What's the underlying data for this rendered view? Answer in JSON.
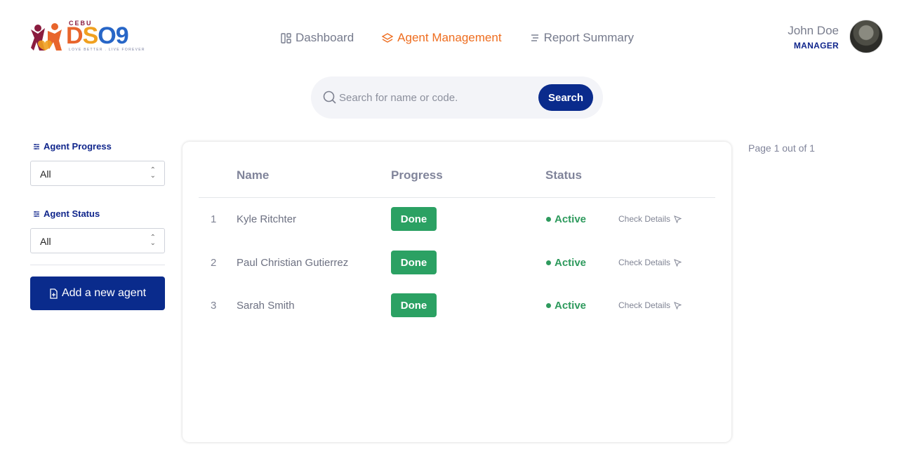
{
  "brand": {
    "top": "CEBU",
    "name_parts": [
      "D",
      "S",
      "O",
      "9"
    ],
    "tagline": "LOVE BETTER . LIVE FOREVER"
  },
  "nav": {
    "items": [
      {
        "label": "Dashboard",
        "icon": "dashboard-icon",
        "active": false
      },
      {
        "label": "Agent Management",
        "icon": "layers-icon",
        "active": true
      },
      {
        "label": "Report Summary",
        "icon": "list-icon",
        "active": false
      }
    ]
  },
  "user": {
    "name": "John Doe",
    "role": "MANAGER"
  },
  "search": {
    "placeholder": "Search for name or code.",
    "value": "",
    "button_label": "Search"
  },
  "filters": {
    "progress": {
      "label": "Agent Progress",
      "selected": "All"
    },
    "status": {
      "label": "Agent Status",
      "selected": "All"
    }
  },
  "add_agent_label": "Add a new agent",
  "table": {
    "columns": [
      "Name",
      "Progress",
      "Status"
    ],
    "rows": [
      {
        "num": "1",
        "name": "Kyle Ritchter",
        "progress": "Done",
        "status": "Active",
        "action": "Check Details"
      },
      {
        "num": "2",
        "name": "Paul Christian Gutierrez",
        "progress": "Done",
        "status": "Active",
        "action": "Check Details"
      },
      {
        "num": "3",
        "name": "Sarah Smith",
        "progress": "Done",
        "status": "Active",
        "action": "Check Details"
      }
    ]
  },
  "pagination": {
    "text": "Page 1 out of 1"
  },
  "colors": {
    "primary": "#0a2b8c",
    "accent": "#ee6d1f",
    "success": "#2ba163"
  }
}
